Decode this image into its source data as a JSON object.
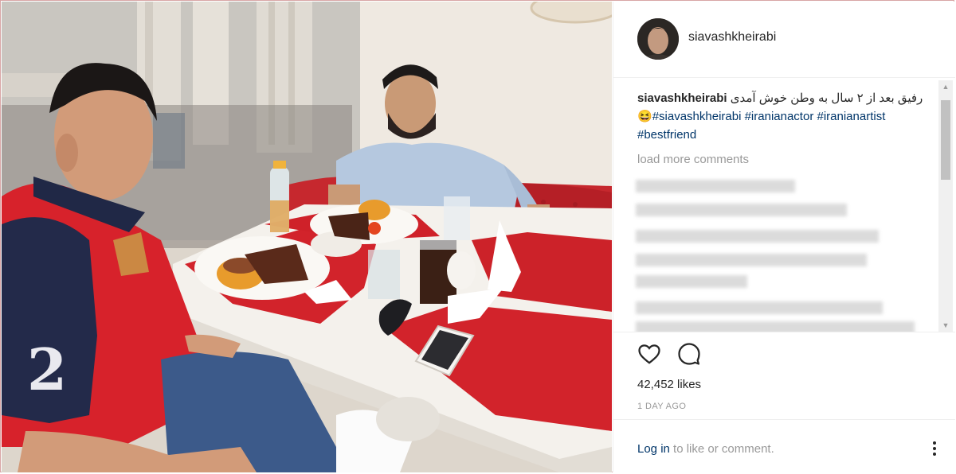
{
  "header": {
    "username": "siavashkheirabi"
  },
  "caption": {
    "username": "siavashkheirabi",
    "text": "رفیق بعد از ۲ سال به وطن خوش آمدی",
    "emoji": "😆",
    "hashtags": [
      "#siavashkheirabi",
      "#iranianactor",
      "#iranianartist",
      "#bestfriend"
    ]
  },
  "comments": {
    "load_more": "load more comments"
  },
  "actions": {
    "like_icon": "heart-icon",
    "comment_icon": "comment-icon"
  },
  "stats": {
    "likes": "42,452 likes",
    "time": "1 DAY AGO"
  },
  "footer": {
    "login_link": "Log in",
    "login_text": " to like or comment."
  },
  "colors": {
    "link": "#003569",
    "muted": "#999999",
    "text": "#262626",
    "frame": "#d8a5a5"
  }
}
